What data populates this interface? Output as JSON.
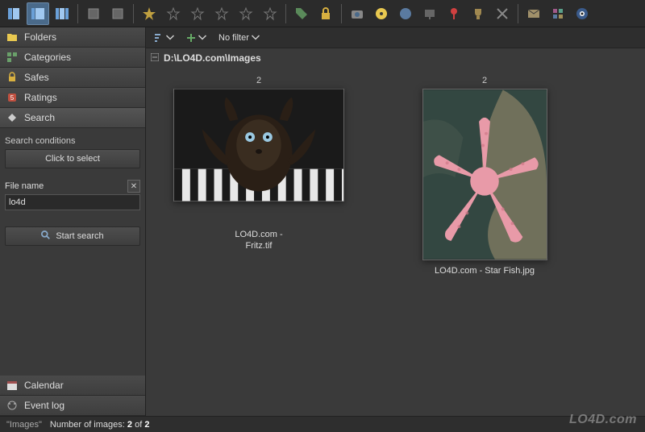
{
  "toolbar": {
    "stars": 5
  },
  "sidebar": {
    "items": [
      {
        "label": "Folders",
        "icon": "folder"
      },
      {
        "label": "Categories",
        "icon": "categories"
      },
      {
        "label": "Safes",
        "icon": "lock"
      },
      {
        "label": "Ratings",
        "icon": "rating"
      },
      {
        "label": "Search",
        "icon": "search"
      }
    ],
    "search": {
      "conditions_title": "Search conditions",
      "select_button": "Click to select",
      "field_label": "File name",
      "field_value": "lo4d",
      "search_button": "Start search"
    },
    "bottom": [
      {
        "label": "Calendar",
        "icon": "calendar"
      },
      {
        "label": "Event log",
        "icon": "eventlog"
      }
    ]
  },
  "filter": {
    "label": "No filter"
  },
  "breadcrumb": "D:\\LO4D.com\\Images",
  "thumbs": [
    {
      "badge": "2",
      "caption": "LO4D.com -\nFritz.tif"
    },
    {
      "badge": "2",
      "caption": "LO4D.com - Star Fish.jpg"
    }
  ],
  "status": {
    "folder": "\"Images\"",
    "label": "Number of images:",
    "count": "2",
    "of": "of",
    "total": "2"
  },
  "watermark": "LO4D.com"
}
